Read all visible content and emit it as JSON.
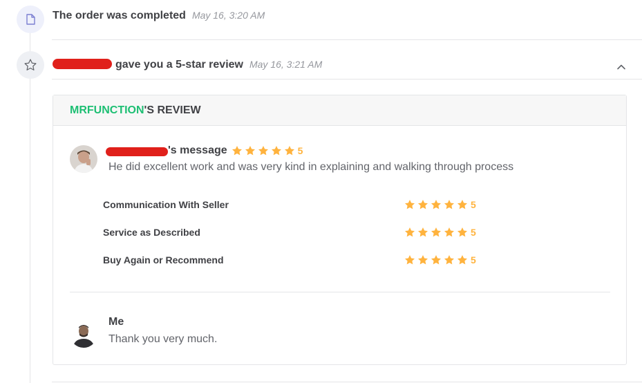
{
  "events": [
    {
      "icon": "document-icon",
      "title": "The order was completed",
      "time": "May 16, 3:20 AM"
    },
    {
      "icon": "star-icon",
      "title": "gave you a 5-star review",
      "time": "May 16, 3:21 AM"
    }
  ],
  "review": {
    "header_brand": "MRFUNCTION",
    "header_suffix": "'S REVIEW",
    "buyer": {
      "label_suffix": "'s message",
      "rating": "5",
      "message": "He did excellent work and was very kind in explaining and walking through process"
    },
    "criteria": [
      {
        "label": "Communication With Seller",
        "rating": "5"
      },
      {
        "label": "Service as Described",
        "rating": "5"
      },
      {
        "label": "Buy Again or Recommend",
        "rating": "5"
      }
    ],
    "reply": {
      "name": "Me",
      "message": "Thank you very much."
    }
  },
  "colors": {
    "brand": "#1dbf73",
    "star": "#ffb33e",
    "redaction": "#e0201b"
  }
}
